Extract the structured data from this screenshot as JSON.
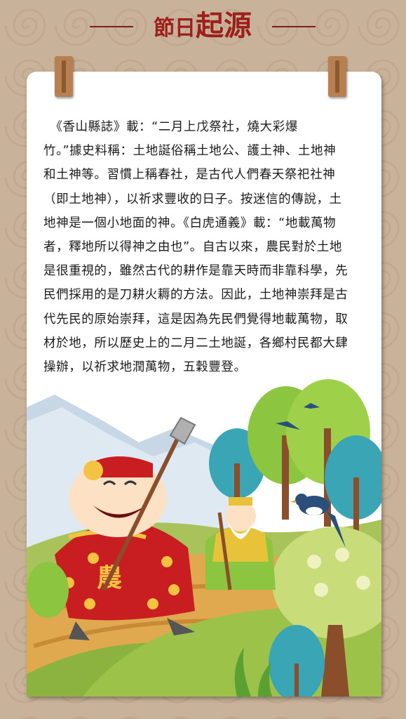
{
  "header": {
    "title_small": "節日",
    "title_big": "起源"
  },
  "article": {
    "lines": [
      "　《香山縣誌》載：“二月上戊祭社，燒大彩爆",
      "竹。”據史料稱：土地誕俗稱土地公、護土神、土地神",
      "和土神等。習慣上稱春社，是古代人們春天祭祀社神",
      "（即土地神），以祈求豐收的日子。按迷信的傳說，土",
      "地神是一個小地面的神。《白虎通義》載：“地載萬物",
      "者，釋地所以得神之由也”。自古以來，農民對於土地",
      "是很重視的，雖然古代的耕作是靠天時而非靠科學，先",
      "民們採用的是刀耕火耨的方法。因此，土地神崇拜是古",
      "代先民的原始崇拜，這是因為先民們覺得地載萬物，取",
      "材於地，所以歷史上的二月二土地誕，各鄉村民都大肆",
      "操辦，以祈求地潤萬物，五穀豐登。"
    ]
  },
  "illustration": {
    "farmer_robe_glyph": "農"
  },
  "colors": {
    "background": "#c9b29a",
    "title": "#9c1f1a",
    "paper": "#ffffff"
  }
}
